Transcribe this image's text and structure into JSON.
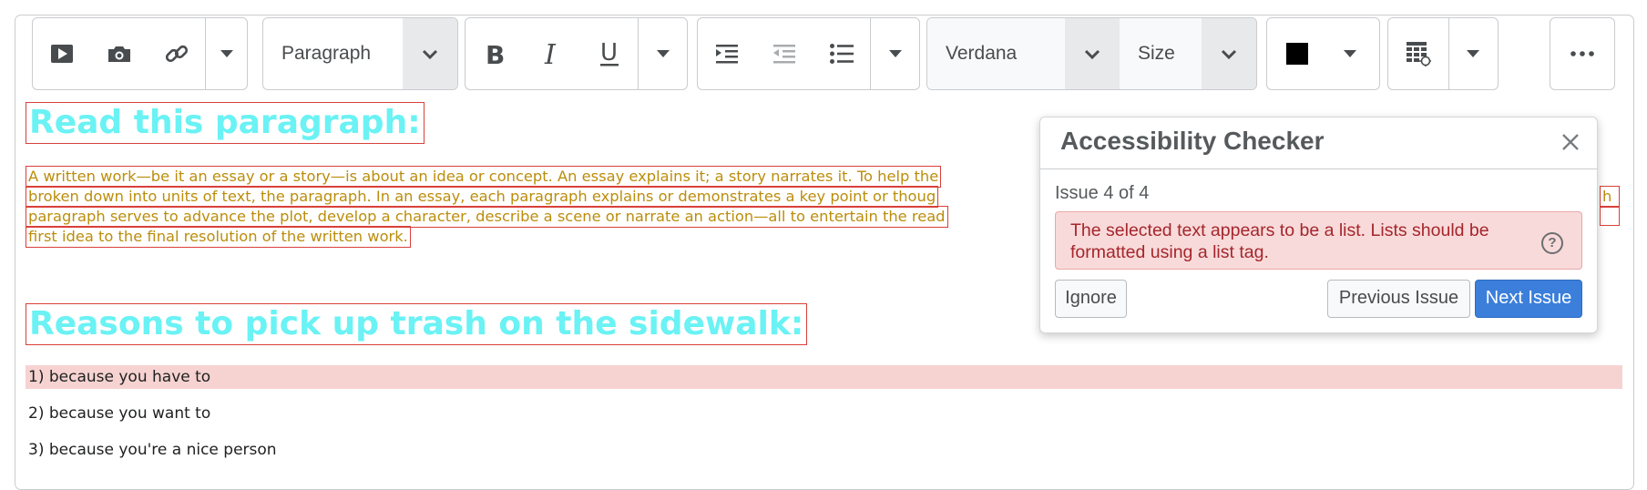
{
  "toolbar": {
    "block_format": "Paragraph",
    "font_family": "Verdana",
    "font_size_placeholder": "Size",
    "text_color": "#000000",
    "icons": [
      "insert-video-icon",
      "insert-image-icon",
      "insert-link-icon",
      "chevron-down-icon",
      "bold-icon",
      "italic-icon",
      "underline-icon",
      "indent-icon",
      "outdent-icon",
      "bullet-list-icon",
      "insert-table-icon",
      "more-icon"
    ]
  },
  "content": {
    "heading1": "Read this paragraph:",
    "paragraph_lines": [
      "A written work—be it an essay or a story—is about an idea or concept. An essay explains it; a story narrates it. To help the",
      "broken down into units of text, the paragraph. In an essay, each paragraph explains or demonstrates a key point or thoug",
      "paragraph serves to advance the plot, develop a character, describe a scene or narrate an action—all to entertain the read",
      "first idea to the final resolution of the written work."
    ],
    "paragraph_overflow_char": "h",
    "heading2": "Reasons to pick up trash on the sidewalk:",
    "list_items": [
      "1) because you have to",
      "2) because you want to",
      "3) because you're a nice person"
    ]
  },
  "checker": {
    "title": "Accessibility Checker",
    "issue_counter": "Issue 4 of 4",
    "message": "The selected text appears to be a list. Lists should be formatted using a list tag.",
    "help_glyph": "?",
    "ignore_label": "Ignore",
    "previous_label": "Previous Issue",
    "next_label": "Next Issue"
  },
  "colors": {
    "heading": "#6af2f4",
    "paragraph": "#bb8d0c",
    "issue_outline": "#d9403a",
    "list_highlight": "#f6d3d1",
    "primary_button": "#3b7fdb",
    "alert_background": "#f9dada",
    "alert_text": "#a4262c"
  }
}
